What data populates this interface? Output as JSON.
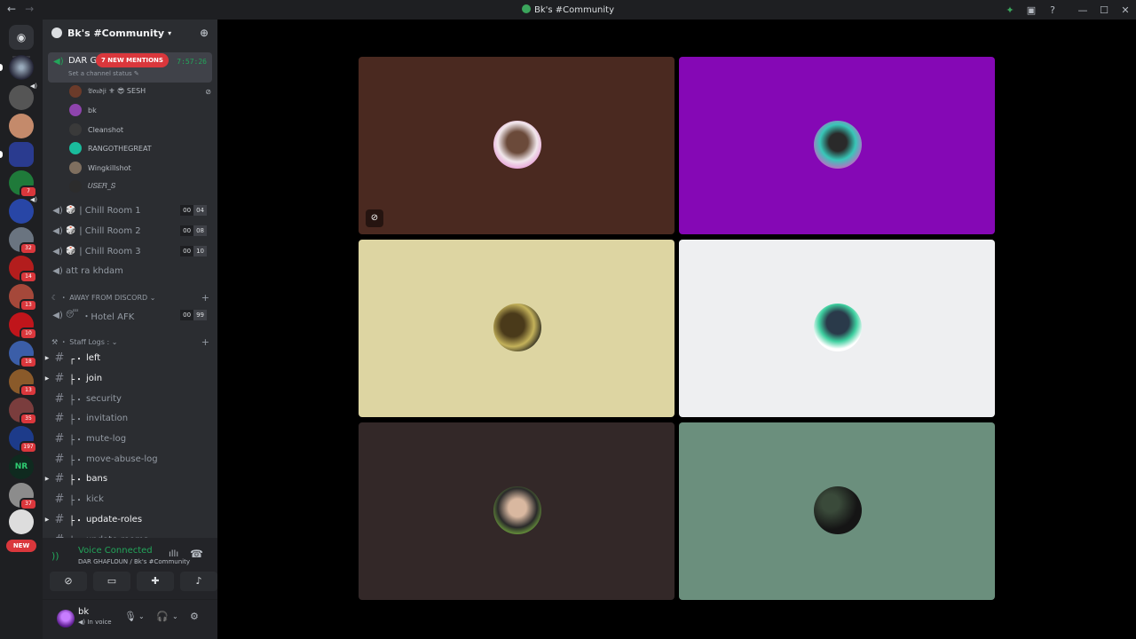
{
  "window": {
    "title": "Bk's #Community",
    "nav_back": "←",
    "nav_forward": "→",
    "minimize": "—",
    "maximize": "☐",
    "close": "✕"
  },
  "servers": {
    "badges": [
      "7",
      "32",
      "14",
      "13",
      "10",
      "18",
      "13",
      "35",
      "197",
      "37"
    ],
    "new_label": "NEW",
    "nr_label": "NR"
  },
  "guild": {
    "name": "Bk's #Community"
  },
  "active_voice": {
    "name": "DAR G",
    "status": "Set a channel status ✎",
    "timer": "7:57:26",
    "mentions": "7 NEW MENTIONS"
  },
  "members": [
    {
      "name": "𝔅𝔬𝔲𝔡𝔧𝔦 ⚜ 😎 SESH",
      "color": "#6b3b2a"
    },
    {
      "name": "bk",
      "color": "#8e44ad"
    },
    {
      "name": "Cleanshot",
      "color": "#3a3a3a"
    },
    {
      "name": "RANGOTHEGREAT",
      "color": "#1abc9c"
    },
    {
      "name": "Wingkillshot",
      "color": "#7f6f5f"
    },
    {
      "name": "𝑈𝑆𝐸𝑅_𝑆",
      "color": "#2c2c2c"
    }
  ],
  "voice_channels": [
    {
      "name": "| Chill Room 1",
      "a": "00",
      "b": "04"
    },
    {
      "name": "| Chill Room 2",
      "a": "00",
      "b": "08"
    },
    {
      "name": "| Chill Room 3",
      "a": "00",
      "b": "10"
    },
    {
      "name": "att ra khdam"
    }
  ],
  "categories": {
    "away": "AWAY FROM DISCORD",
    "staff": "Staff Logs :"
  },
  "hotel": {
    "name": "・Hotel AFK",
    "a": "00",
    "b": "99"
  },
  "text_channels": [
    {
      "name": "left",
      "tree": "┌・",
      "unread": true,
      "arrow": true
    },
    {
      "name": "join",
      "tree": "├・",
      "unread": true,
      "arrow": true
    },
    {
      "name": "security",
      "tree": "├・",
      "unread": false,
      "arrow": false
    },
    {
      "name": "invitation",
      "tree": "├・",
      "unread": false,
      "arrow": false
    },
    {
      "name": "mute-log",
      "tree": "├・",
      "unread": false,
      "arrow": false
    },
    {
      "name": "move-abuse-log",
      "tree": "├・",
      "unread": false,
      "arrow": false
    },
    {
      "name": "bans",
      "tree": "├・",
      "unread": true,
      "arrow": true
    },
    {
      "name": "kick",
      "tree": "├・",
      "unread": false,
      "arrow": false
    },
    {
      "name": "update-roles",
      "tree": "├・",
      "unread": true,
      "arrow": true
    },
    {
      "name": "update-rooms",
      "tree": "├・",
      "unread": false,
      "arrow": false
    }
  ],
  "voice_panel": {
    "label": "Voice Connected",
    "sub": "DAR GHAFLOUN / Bk's #Community"
  },
  "user": {
    "name": "bk",
    "status": "In voice"
  },
  "tiles": [
    {
      "bg": "#4a2920",
      "muted": true
    },
    {
      "bg": "#8508b5",
      "muted": false
    },
    {
      "bg": "#ddd5a2",
      "muted": false
    },
    {
      "bg": "#eeeff1",
      "muted": false
    },
    {
      "bg": "#332828",
      "muted": false
    },
    {
      "bg": "#6b8f7d",
      "muted": false
    }
  ]
}
